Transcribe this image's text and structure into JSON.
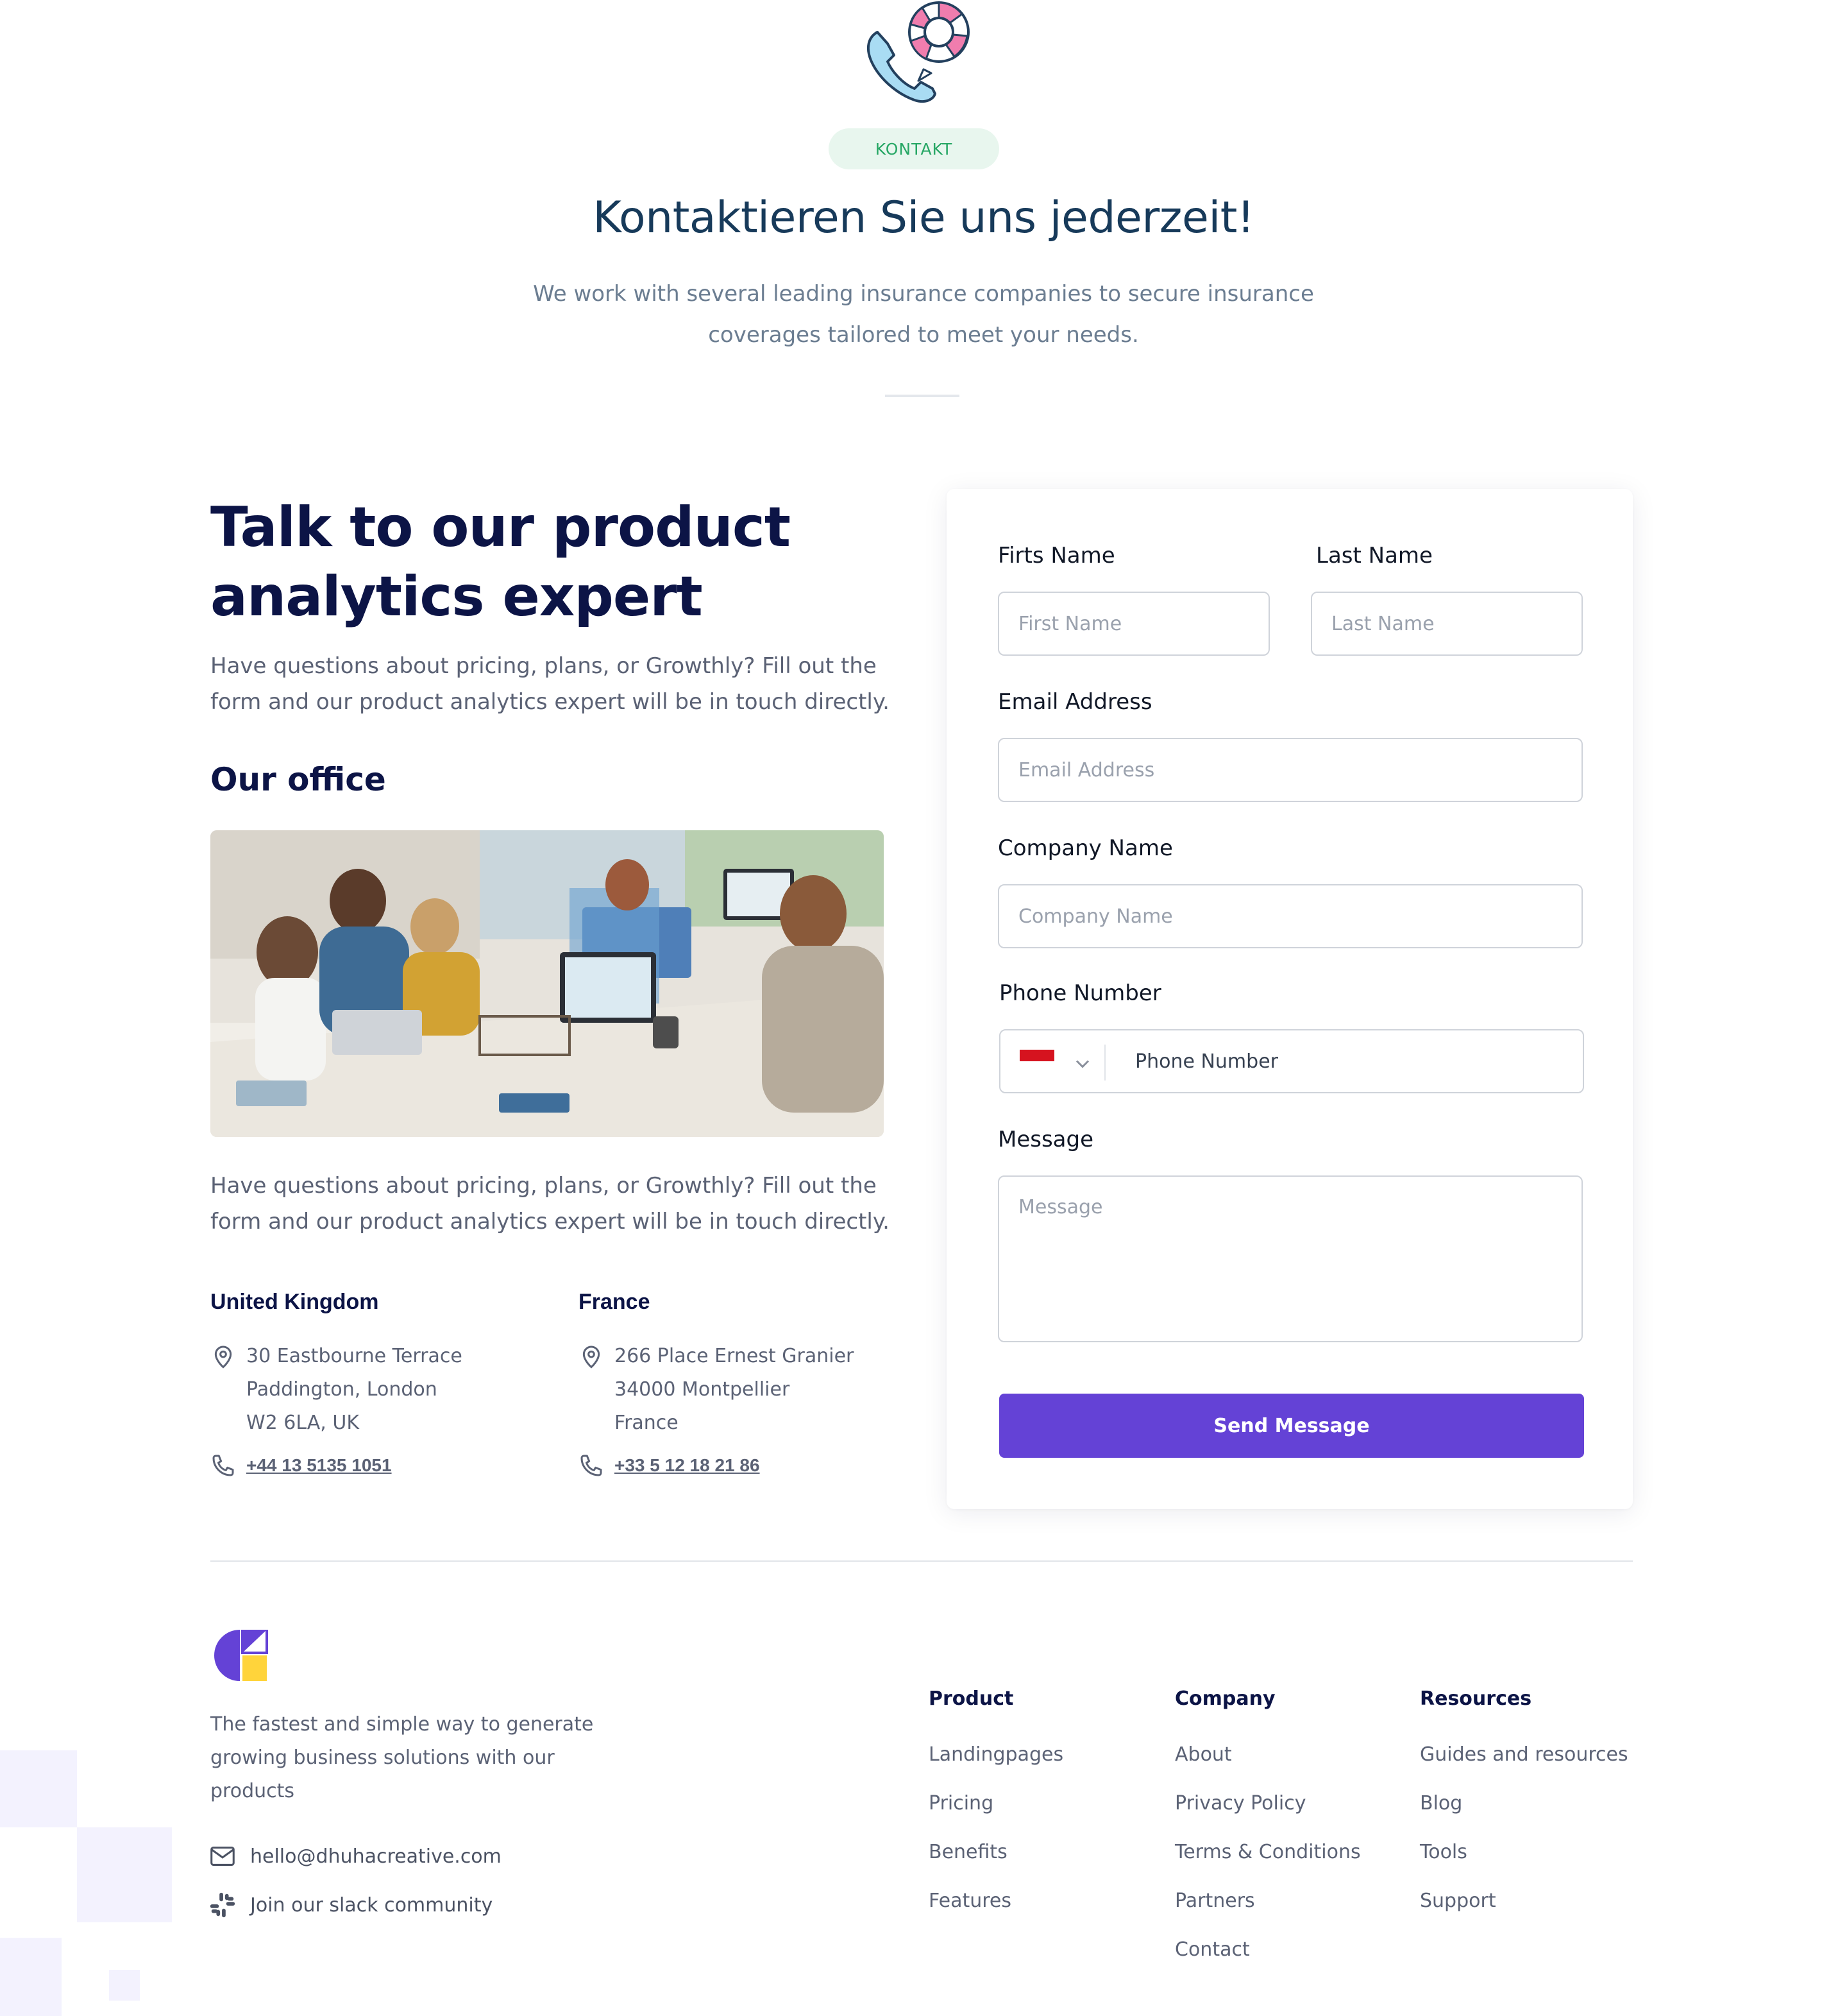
{
  "hero": {
    "badge": "KONTAKT",
    "title": "Kontaktieren Sie uns jederzeit!",
    "subtitle": "We work with several leading insurance companies to secure insurance coverages tailored to meet your needs."
  },
  "intro": {
    "title": "Talk to our product analytics expert",
    "description": "Have questions about pricing, plans, or Growthly? Fill out the form and our product analytics expert will be in touch directly."
  },
  "office": {
    "title": "Our office",
    "description": "Have questions about pricing, plans, or Growthly? Fill out the form and our product analytics expert will be in touch directly.",
    "locations": [
      {
        "country": "United Kingdom",
        "address": [
          "30 Eastbourne Terrace",
          "Paddington, London",
          "W2 6LA, UK"
        ],
        "phone": "+44 13 5135 1051"
      },
      {
        "country": "France",
        "address": [
          "266 Place Ernest Granier",
          "34000 Montpellier",
          "France"
        ],
        "phone": "+33 5 12 18 21 86"
      }
    ]
  },
  "form": {
    "first_name_label": "Firts Name",
    "first_name_placeholder": "First Name",
    "last_name_label": "Last Name",
    "last_name_placeholder": "Last Name",
    "email_label": "Email Address",
    "email_placeholder": "Email Address",
    "company_label": "Company Name",
    "company_placeholder": "Company Name",
    "phone_label": "Phone Number",
    "phone_placeholder": "Phone Number",
    "message_label": "Message",
    "message_placeholder": "Message",
    "submit_label": "Send Message"
  },
  "footer": {
    "tagline": "The fastest and simple way to generate growing business solutions with our products",
    "email": "hello@dhuhacreative.com",
    "slack": "Join our slack community",
    "columns": [
      {
        "title": "Product",
        "links": [
          "Landingpages",
          "Pricing",
          "Benefits",
          "Features"
        ]
      },
      {
        "title": "Company",
        "links": [
          "About",
          "Privacy Policy",
          "Terms & Conditions",
          "Partners",
          "Contact"
        ]
      },
      {
        "title": "Resources",
        "links": [
          "Guides and resources",
          "Blog",
          "Tools",
          "Support"
        ]
      }
    ]
  },
  "colors": {
    "accent": "#6442d6",
    "badge_bg": "#e8f6ee",
    "badge_text": "#27a765",
    "heading": "#0c1446",
    "hero_title": "#173a5a"
  },
  "icons": [
    "support-call-icon",
    "location-pin-icon",
    "phone-icon",
    "chevron-down-icon",
    "mail-icon",
    "slack-icon",
    "brand-logo"
  ]
}
